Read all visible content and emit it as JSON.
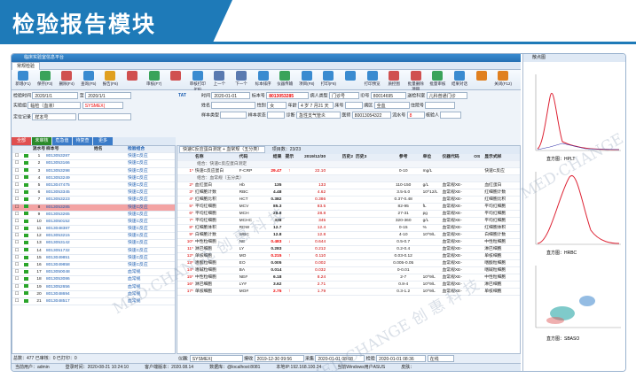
{
  "banner": {
    "title": "检验报告模块"
  },
  "app": {
    "window_title": "临床实验室信息平台",
    "tab": "常规检验"
  },
  "toolbar": [
    "新增(F1)",
    "保存(F3)",
    "删除(F4)",
    "查询(F5)",
    "报告(F6)",
    "",
    "审核(F7)",
    "",
    "审核打印(F9)",
    "上一个",
    "下一个",
    "标本排序",
    "仪器传输",
    "项目(F8)",
    "打印(F8)",
    "",
    "打印预览",
    "质控图",
    "批量删除项目",
    "批量审核",
    "结果对话",
    "",
    "关闭(F12)"
  ],
  "filters": {
    "date_label": "检验时间",
    "date_from": "2020/1/1",
    "date_to": "2020/1/1",
    "group_label": "实验组",
    "group_value": "临检（血液）",
    "instrument_value": "SYSMEX(",
    "locate_label": "定位记录",
    "locate_value": "样本号"
  },
  "patient": {
    "time_label": "时间",
    "time_value": "2020-01-01",
    "sample_no_label": "标本号",
    "sample_no_value": "8013053285",
    "visit_label": "病人类型",
    "visit_value": "门诊号",
    "id_label": "ID号",
    "id_value": "80014695",
    "dept_label": "送检科室",
    "dept_value": "儿科普通门诊",
    "name_label": "姓名",
    "sex_label": "性别",
    "sex_value": "女",
    "age_label": "年龄",
    "age_value": "4 岁 7 月21 天",
    "bed_label": "床号",
    "ward_label": "病区",
    "ward_value": "全血",
    "cost_label": "住院号",
    "diag_label": "诊断",
    "sample_type_label": "样本类型",
    "sample_state_label": "样本状态",
    "sample_state_value": "急性支气管炎",
    "doctor_label": "医师",
    "doctor_value": "80013054322",
    "barcode_label": "流水号",
    "barcode_value": "8",
    "send_label": "核验人",
    "report_label": "报告人",
    "remark_label": "备注",
    "remark_value": "TAT"
  },
  "left_tabs": [
    {
      "label": "全部",
      "color": "#e05050"
    },
    {
      "label": "未审核",
      "color": "#2a8a2a"
    },
    {
      "label": "危急值",
      "color": "#3a7bc8"
    },
    {
      "label": "待复查",
      "color": "#3a7bc8"
    },
    {
      "label": "更多",
      "color": "#3a7bc8"
    }
  ],
  "left_headers": [
    "",
    "流水号",
    "样本号",
    "姓名",
    "检验组合"
  ],
  "samples": [
    {
      "seq": "1",
      "id": "8013053287",
      "combo": "快速C反应"
    },
    {
      "seq": "2",
      "id": "8013053166",
      "combo": "快速C反应"
    },
    {
      "seq": "3",
      "id": "8013053298",
      "combo": "快速C反应"
    },
    {
      "seq": "4",
      "id": "8013053249",
      "combo": "快速C反应"
    },
    {
      "seq": "5",
      "id": "8013047475",
      "combo": "快速C反应"
    },
    {
      "seq": "6",
      "id": "8013053345",
      "combo": "快速C反应"
    },
    {
      "seq": "7",
      "id": "8013053223",
      "combo": "快速C反应"
    },
    {
      "seq": "8",
      "id": "8013053285",
      "combo": "快速C反应"
    },
    {
      "seq": "9",
      "id": "8013053265",
      "combo": "快速C反应"
    },
    {
      "seq": "10",
      "id": "8013050152",
      "combo": "快速C反应"
    },
    {
      "seq": "11",
      "id": "8013048387",
      "combo": "快速C反应"
    },
    {
      "seq": "12",
      "id": "8013053215",
      "combo": "快速C反应"
    },
    {
      "seq": "13",
      "id": "8013053142",
      "combo": "快速C反应"
    },
    {
      "seq": "14",
      "id": "8013051732",
      "combo": "快速C反应"
    },
    {
      "seq": "15",
      "id": "8013049851",
      "combo": "快速C反应"
    },
    {
      "seq": "16",
      "id": "8013049858",
      "combo": "快速C反应"
    },
    {
      "seq": "17",
      "id": "8013050048",
      "combo": "血常规"
    },
    {
      "seq": "18",
      "id": "8013053086",
      "combo": "血常规"
    },
    {
      "seq": "19",
      "id": "8013052656",
      "combo": "血常规"
    },
    {
      "seq": "20",
      "id": "8013048694",
      "combo": "血常规"
    },
    {
      "seq": "21",
      "id": "8013048517",
      "combo": "血常规"
    }
  ],
  "selected_seq": "8",
  "result_tabs": "快速C反应蛋白测定 + 血常规（五分类）",
  "result_counts": "项目数：23/23",
  "result_headers": [
    "",
    "名称",
    "代码",
    "结果",
    "提示",
    "2019/12/30",
    "历史2",
    "历史3",
    "参考",
    "单位",
    "仪器代码",
    "OS",
    "显示式样"
  ],
  "groups": [
    {
      "title": "组合：快速C反应蛋白测定",
      "rows": [
        {
          "no": "1*",
          "name": "快速C反应蛋白",
          "code": "F-CRP",
          "result": "29.47",
          "flag": "↑",
          "h1": "22.10",
          "ref": "0-10",
          "unit": "mg/L",
          "inst": "",
          "disp": "快速C反应"
        }
      ]
    },
    {
      "title": "组合：血常规（五分类）",
      "rows": [
        {
          "no": "2*",
          "name": "血红蛋白",
          "code": "Hb",
          "result": "135",
          "flag": "",
          "h1": "133",
          "ref": "110-150",
          "unit": "g/L",
          "inst": "血常规XE-",
          "disp": "血红蛋白"
        },
        {
          "no": "3*",
          "name": "红细胞计数",
          "code": "RBC",
          "result": "4.48",
          "flag": "",
          "h1": "4.62",
          "ref": "3.5-5.0",
          "unit": "10^12/L",
          "inst": "血常规XE-",
          "disp": "红细胞计数"
        },
        {
          "no": "4*",
          "name": "红细胞比积",
          "code": "HCT",
          "result": "0.382",
          "flag": "",
          "h1": "0.386",
          "ref": "0.37-0.48",
          "unit": "",
          "inst": "血常规XE-",
          "disp": "红细胞比积"
        },
        {
          "no": "5*",
          "name": "平均红细胞",
          "code": "MCV",
          "result": "85.3",
          "flag": "",
          "h1": "83.5",
          "ref": "82-95",
          "unit": "fL",
          "inst": "血常规XE-",
          "disp": "平均红细胞"
        },
        {
          "no": "6*",
          "name": "平均红细胞",
          "code": "MCH",
          "result": "28.8",
          "flag": "",
          "h1": "28.8",
          "ref": "27-31",
          "unit": "pg",
          "inst": "血常规XE-",
          "disp": "平均红细胞"
        },
        {
          "no": "7*",
          "name": "平均红细胞",
          "code": "MCHC",
          "result": "338",
          "flag": "",
          "h1": "345",
          "ref": "320-360",
          "unit": "g/L",
          "inst": "血常规XE-",
          "disp": "平均红细胞"
        },
        {
          "no": "8*",
          "name": "红细胞体积",
          "code": "RDW",
          "result": "12.7",
          "flag": "",
          "h1": "12.4",
          "ref": "0-15",
          "unit": "%",
          "inst": "血常规XE-",
          "disp": "红细胞体积"
        },
        {
          "no": "9*",
          "name": "白细胞计数",
          "code": "WBC",
          "result": "12.8",
          "flag": "",
          "h1": "12.8",
          "ref": "4-10",
          "unit": "10^9/L",
          "inst": "血常规XE-",
          "disp": "白细胞计数"
        },
        {
          "no": "10*",
          "name": "中性粒细胞",
          "code": "NE",
          "result": "0.483",
          "flag": "↓",
          "h1": "0.644",
          "ref": "0.5-0.7",
          "unit": "",
          "inst": "血常规XE-",
          "disp": "中性粒细胞"
        },
        {
          "no": "11*",
          "name": "淋巴细胞",
          "code": "LY",
          "result": "0.283",
          "flag": "",
          "h1": "0.212",
          "ref": "0.2-0.4",
          "unit": "",
          "inst": "血常规XE-",
          "disp": "淋巴细胞"
        },
        {
          "no": "12*",
          "name": "单核细胞",
          "code": "MO",
          "result": "0.215",
          "flag": "↑",
          "h1": "0.110",
          "ref": "0.03-0.12",
          "unit": "",
          "inst": "血常规XE-",
          "disp": "单核细胞"
        },
        {
          "no": "13*",
          "name": "嗜酸粒细胞",
          "code": "EO",
          "result": "0.005",
          "flag": "",
          "h1": "0.002",
          "ref": "0.005-0.05",
          "unit": "",
          "inst": "血常规XE-",
          "disp": "嗜酸粒细胞"
        },
        {
          "no": "14*",
          "name": "嗜碱粒细胞",
          "code": "BA",
          "result": "0.014",
          "flag": "",
          "h1": "0.032",
          "ref": "0-0.01",
          "unit": "",
          "inst": "血常规XE-",
          "disp": "嗜碱粒细胞"
        },
        {
          "no": "15*",
          "name": "中性粒细胞",
          "code": "NE#",
          "result": "6.18",
          "flag": "",
          "h1": "8.24",
          "ref": "2-7",
          "unit": "10^9/L",
          "inst": "血常规XE-",
          "disp": "中性粒细胞"
        },
        {
          "no": "16*",
          "name": "淋巴细胞",
          "code": "LY#",
          "result": "3.62",
          "flag": "",
          "h1": "2.71",
          "ref": "0.8-4",
          "unit": "10^9/L",
          "inst": "血常规XE-",
          "disp": "淋巴细胞"
        },
        {
          "no": "17*",
          "name": "单核细胞",
          "code": "MO#",
          "result": "2.75",
          "flag": "↑",
          "h1": "1.79",
          "ref": "0.3-1.2",
          "unit": "10^9/L",
          "inst": "血常规XE-",
          "disp": "单核细胞"
        }
      ]
    }
  ],
  "bottom": {
    "instrument_label": "仪器:",
    "instrument_value": "SYSMEX(",
    "receive_label": "接收",
    "receive_time": "2019-12-30 09:56",
    "sample_label": "采集",
    "sample_time": "2020-01-01 08:08",
    "check_label": "检验",
    "check_time": "2020-01-01 08:36",
    "status_value": "在线",
    "audit_label": "审核",
    "remark_label": "备注"
  },
  "left_stats": "总数：477   已审核：0   已打印：0",
  "left_radio": [
    "全部",
    "通过",
    "未通过",
    "未处理"
  ],
  "statusbar": [
    "当前用户：admin",
    "登录时间：2020-08-21 10:24:10",
    "客户端版本：2020.08.14",
    "数据库：@localhost:8081",
    "本地IP:192.168.100.24",
    "当前Windows用户ASUS",
    "皮肤："
  ],
  "side": {
    "title": "散点图",
    "plots": [
      "直方图：HPLT",
      "直方图：HRBC",
      "直方图：SBASO"
    ]
  },
  "watermark": "MED·CHANGE 创 惠 科 技"
}
